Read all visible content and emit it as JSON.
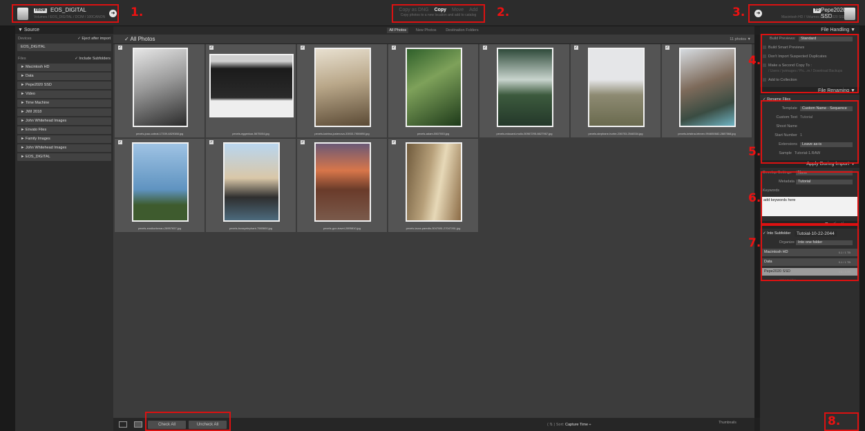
{
  "top": {
    "from_tag": "FROM",
    "from_name": "EOS_DIGITAL",
    "from_path": "Volumes / EOS_DIGITAL / DCIM / 100CANON",
    "mode_options": [
      "Copy as DNG",
      "Copy",
      "Move",
      "Add"
    ],
    "mode_active": "Copy",
    "mode_desc": "Copy photos to a new location and add to catalog",
    "to_tag": "TO",
    "to_name": "Pepe2020 SSD",
    "to_path": "Macintosh HD / Volumes / Pepe2020 SSD"
  },
  "callouts": [
    "1.",
    "2.",
    "3.",
    "4.",
    "5.",
    "6.",
    "7.",
    "8."
  ],
  "left": {
    "header": "▼ Source",
    "devices_label": "Devices",
    "eject_label": "✓ Eject after import",
    "device_item": "EOS_DIGITAL",
    "files_label": "Files",
    "subfolders_label": "✓ Include Subfolders",
    "items": [
      "► Macintosh HD",
      "► Data",
      "► Pepe2020 SSD",
      "► Video",
      "► Time Machine",
      "► JWI 2018",
      "► John Whitehead Images",
      "► Envato Files",
      "► Family Images",
      "► John Whitehead Images",
      "► EOS_DIGITAL"
    ]
  },
  "center": {
    "tabs": [
      "All Photos",
      "New Photos",
      "Destination Folders"
    ],
    "title": "✓  All Photos",
    "count": "11 photos ▼",
    "photos": [
      {
        "file": "pexels-joao-cabral-17339-4829388.jpg"
      },
      {
        "file": "pexels-eggenkaz-5675004.jpg"
      },
      {
        "file": "pexels-katrina-justenova-33933-7959890.jpg"
      },
      {
        "file": "pexels-adam-5507053.jpg"
      },
      {
        "file": "pexels-edouard-mollo-50967295-6627967.jpg"
      },
      {
        "file": "pexels-stephane-hurbe-236753-2548334.jpg"
      },
      {
        "file": "pexels-kristina-lebnev-994650682-2887568.jpg"
      },
      {
        "file": "pexels-eosikorkenau-28957657.jpg"
      },
      {
        "file": "pexels-bussyelephant-7583600.jpg"
      },
      {
        "file": "pexels-gun-travel-2895810.jpg"
      },
      {
        "file": "pexels-laura-paredis-3047081-27047261.jpg"
      }
    ],
    "check_all": "Check All",
    "uncheck_all": "Uncheck All",
    "sort_label": "Sort:",
    "sort_value": "Capture Time ÷",
    "sort_icon": "( ⇅ )",
    "thumbnails_label": "Thumbnails"
  },
  "right": {
    "file_handling": "File Handling  ▼",
    "build_previews_label": "Build Previews:",
    "build_previews_value": "Standard",
    "smart_previews": "Build Smart Previews",
    "no_duplicates": "Don't Import Suspected Duplicates",
    "second_copy": "Make a Second Copy To :",
    "second_copy_path": "/ Users / jwimages / Pic...m / Download Backups",
    "add_collection": "Add to Collection",
    "file_renaming": "File Renaming  ▼",
    "rename_files": "✓ Rename Files",
    "template_label": "Template",
    "template_value": "Custom Name - Sequence",
    "custom_text_label": "Custom Text",
    "custom_text_value": "Tutorial",
    "shoot_name_label": "Shoot Name",
    "start_number_label": "Start Number",
    "start_number_value": "1",
    "extensions_label": "Extensions",
    "extensions_value": "Leave as-is",
    "sample_label": "Sample",
    "sample_value": "Tutorial-1.RAW",
    "apply_during": "Apply During Import  ▼",
    "develop_label": "Develop Settings",
    "develop_value": "None",
    "metadata_label": "Metadata",
    "metadata_value": "Tutorial",
    "keywords_label": "Keywords",
    "keywords_value": "add keywords here",
    "destination": "Destination  ▼",
    "plus": "+.",
    "into_subfolder": "✓ Into Subfolder",
    "subfolder_value": "Tutoial-10-22-2044",
    "organize_label": "Organize",
    "organize_value": "Into one folder",
    "volumes": [
      {
        "name": "Macintosh HD",
        "cap": "0.1 / 1 TB"
      },
      {
        "name": "Data",
        "cap": "0.1 / 1 TB"
      },
      {
        "name": "Pepe2020 SSD",
        "cap": "2.6 / 4 TB"
      }
    ],
    "below_item": "2024 Folder"
  }
}
